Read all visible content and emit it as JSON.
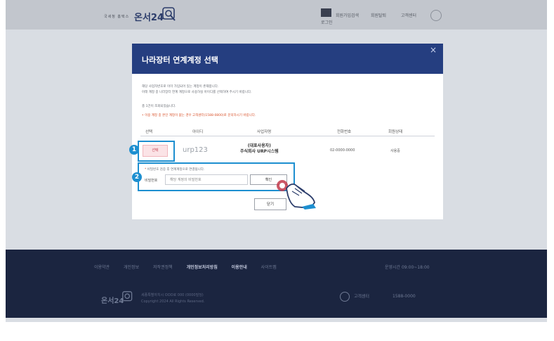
{
  "header": {
    "brand_small": "국세청 홈택스",
    "brand": "온서24",
    "nav": [
      "로그인",
      "회원가입",
      "검색"
    ],
    "links": [
      "회원탈퇴",
      "고객센터"
    ],
    "icons": {
      "brand_mark": "magnifier-logo-icon",
      "settings": "gear-icon"
    }
  },
  "modal": {
    "title": "나라장터 연계계정 선택",
    "close_icon": "×",
    "desc_lines": [
      "해당 사업자번호로 이미 가입되어 있는 계정이 존재합니다.",
      "아래 계정 중 나라장터 연계 계정으로 사용하실 아이디를 선택하여 주시기 바랍니다.",
      "총 1건이 조회되었습니다."
    ],
    "notice": "• 이용 계정 중 본인 계정이 없는 경우 고객센터(1588-0800)로 문의하시기 바랍니다.",
    "table": {
      "headers": [
        "선택",
        "아이디",
        "사업자명",
        "전화번호",
        "회원상태"
      ],
      "row": {
        "select_label": "선택",
        "id": "urp123",
        "biz_name_1": "(대표사용자)",
        "biz_name_2": "주식회사 URP시스템",
        "phone": "02-0000-0000",
        "status": "사용중"
      }
    },
    "badges": [
      "1",
      "2"
    ],
    "auth": {
      "note_prefix": "*",
      "note": "비밀번호 검증 후 연계계정으로 연결됩니다.",
      "label": "비밀번호",
      "placeholder": "해당 계정의 비밀번호",
      "confirm": "확인"
    },
    "close_button": "닫기"
  },
  "footer": {
    "links": [
      "이용약관",
      "개인정보",
      "저작권정책",
      "개인정보처리방침",
      "이용안내",
      "사이트맵"
    ],
    "right_text": "운영시간 09:00~18:00",
    "logo": "온서24",
    "address_lines": [
      "세종특별자치시 OOO로 000 (0000빌딩)",
      "Copyright 2024 All Rights Reserved."
    ],
    "call_label": "고객센터",
    "call_phone": "1588-0000"
  },
  "colors": {
    "primary": "#253e80",
    "highlight": "#1d8fd0",
    "footer": "#1b2540"
  }
}
